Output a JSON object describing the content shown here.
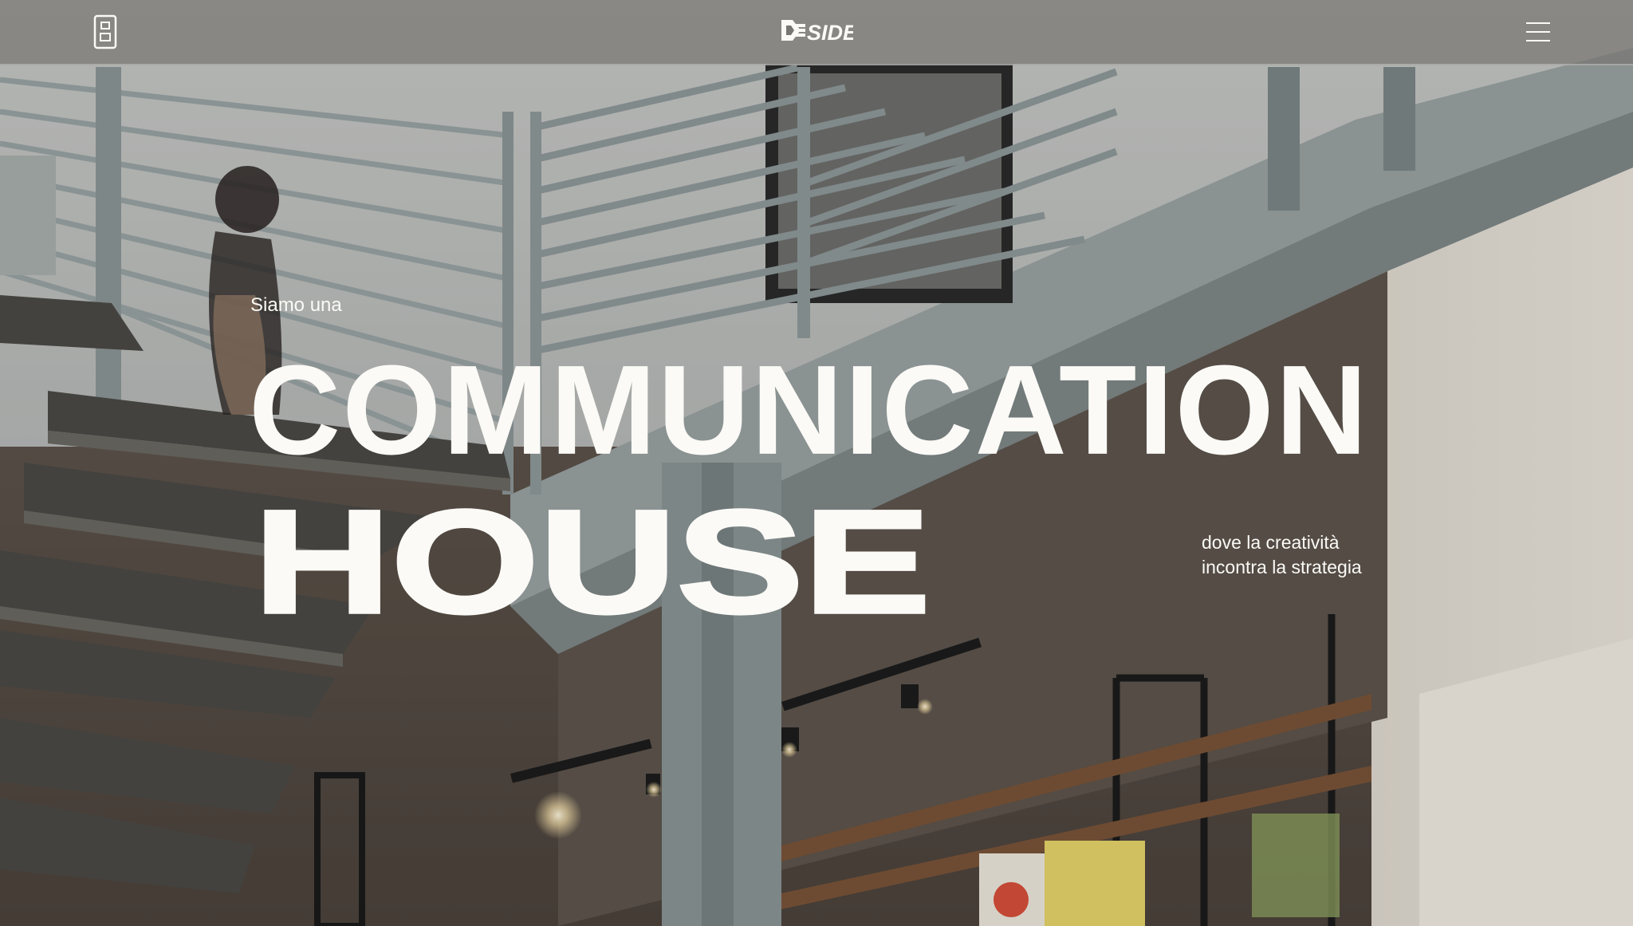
{
  "header": {
    "logo_text": "DESIDE",
    "phone_icon": "phone-icon",
    "menu_icon": "hamburger-menu-icon"
  },
  "hero": {
    "kicker": "Siamo una",
    "headline_line1": "COMMUNICATION",
    "headline_line2": "HOUSE",
    "tagline_line1": "dove la creatività",
    "tagline_line2": "incontra la strategia"
  },
  "colors": {
    "text": "#fbfaf6",
    "header_bg": "#787672",
    "wall": "#d8d2c8",
    "steel": "#8e9a9c"
  }
}
